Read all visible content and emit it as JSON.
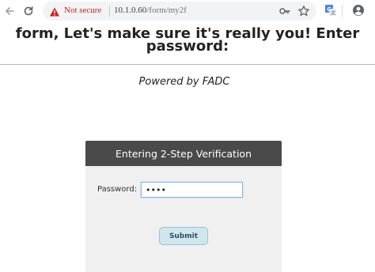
{
  "browser": {
    "security_label": "Not secure",
    "url_host": "10.1.0.60",
    "url_path": "/form/my2f",
    "colors": {
      "warning": "#c5221f",
      "omnibox_bg": "#f1f3f4"
    }
  },
  "page": {
    "title": "form, Let's make sure it's really you! Enter password:",
    "powered_by": "Powered by FADC"
  },
  "panel": {
    "header": "Entering 2-Step Verification",
    "password_label": "Password:",
    "password_value": "••••",
    "submit_label": "Submit",
    "colors": {
      "header_bg": "#4a4a4a",
      "body_bg": "#f0f0f0",
      "button_bg": "#cfe6ef"
    }
  }
}
